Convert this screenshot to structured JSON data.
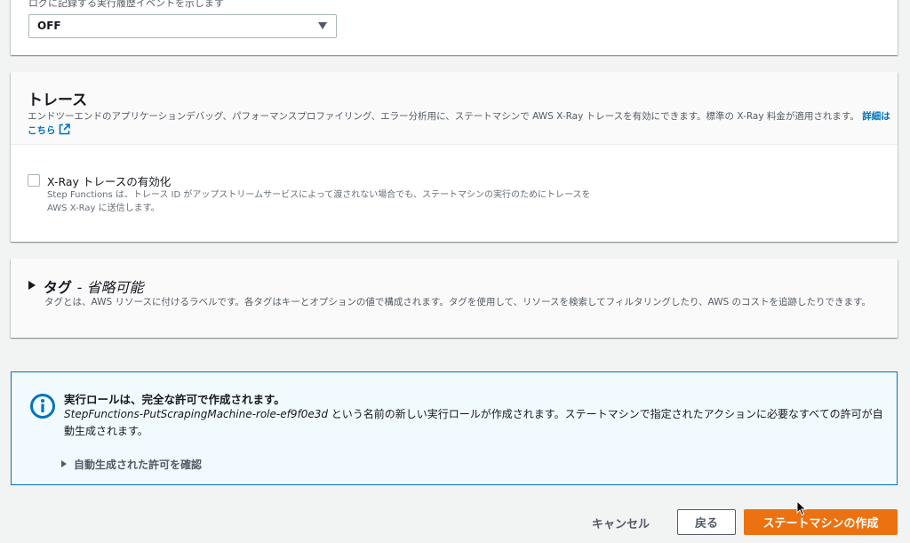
{
  "logging": {
    "partial_label": "ログに記録する実行履歴イベントを示します",
    "level_value": "OFF"
  },
  "tracing": {
    "title": "トレース",
    "description": "エンドツーエンドのアプリケーションデバッグ、パフォーマンスプロファイリング、エラー分析用に、ステートマシンで AWS X-Ray トレースを有効にできます。標準の X-Ray 料金が適用されます。",
    "learn_more_label": "詳細はこちら",
    "checkbox_label": "X-Ray トレースの有効化",
    "checkbox_checked": false,
    "checkbox_desc_line1": "Step Functions は、トレース ID がアップストリームサービスによって渡されない場合でも、ステートマシンの実行のためにトレースを",
    "checkbox_desc_line2": "AWS X-Ray に送信します。"
  },
  "tags": {
    "title": "タグ",
    "optional": "- 省略可能",
    "description": "タグとは、AWS リソースに付けるラベルです。各タグはキーとオプションの値で構成されます。タグを使用して、リソースを検索してフィルタリングしたり、AWS のコストを追跡したりできます。"
  },
  "alert": {
    "title": "実行ロールは、完全な許可で作成されます。",
    "role_name": "StepFunctions-PutScrapingMachine-role-ef9f0e3d",
    "body": " という名前の新しい実行ロールが作成されます。ステートマシンで指定されたアクションに必要なすべての許可が自動生成されます。",
    "expander_label": "自動生成された許可を確認"
  },
  "footer": {
    "cancel_label": "キャンセル",
    "back_label": "戻る",
    "create_label": "ステートマシンの作成"
  },
  "colors": {
    "primary": "#ec7211",
    "link": "#0073bb",
    "info_bg": "#f1faff"
  }
}
